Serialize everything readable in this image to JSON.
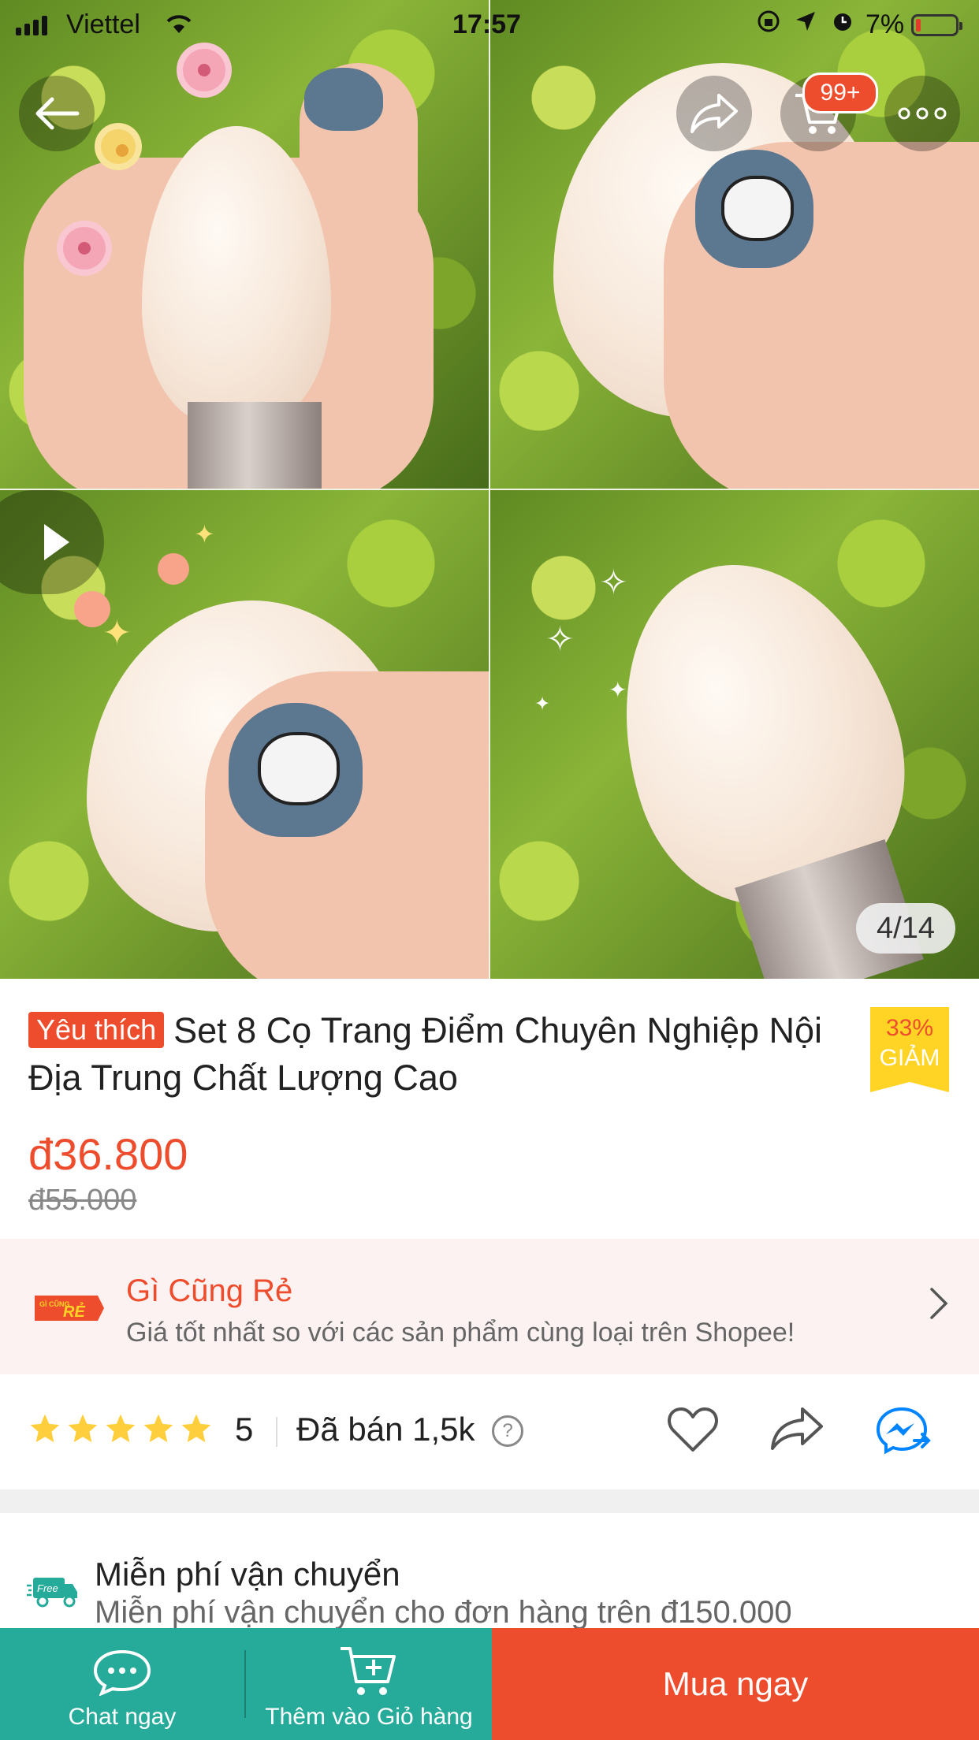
{
  "status_bar": {
    "carrier": "Viettel",
    "time": "17:57",
    "battery": "7%"
  },
  "gallery": {
    "counter": "4/14"
  },
  "header": {
    "cart_badge": "99+"
  },
  "product": {
    "badge": "Yêu thích",
    "title": "Set 8 Cọ Trang Điểm Chuyên Nghiệp Nội Địa Trung Chất Lượng Cao",
    "discount_percent": "33%",
    "discount_label": "GIẢM",
    "price": "đ36.800",
    "original_price": "đ55.000"
  },
  "promo": {
    "logo_text_top": "GÌ CŨNG",
    "logo_text_main": "RẺ",
    "title": "Gì Cũng Rẻ",
    "subtitle": "Giá tốt nhất so với các sản phẩm cùng loại trên Shopee!"
  },
  "rating": {
    "stars": 5,
    "value": "5",
    "sold": "Đã bán 1,5k",
    "help": "?"
  },
  "shipping": {
    "icon_label": "Free",
    "title": "Miễn phí vận chuyển",
    "subtitle": "Miễn phí vận chuyển cho đơn hàng trên đ150.000"
  },
  "bottom_bar": {
    "chat_label": "Chat ngay",
    "add_cart_label": "Thêm vào Giỏ hàng",
    "buy_label": "Mua ngay"
  },
  "colors": {
    "accent": "#ee4d2d",
    "teal": "#26aa99",
    "star": "#ffce3d",
    "messenger": "#0084ff"
  }
}
